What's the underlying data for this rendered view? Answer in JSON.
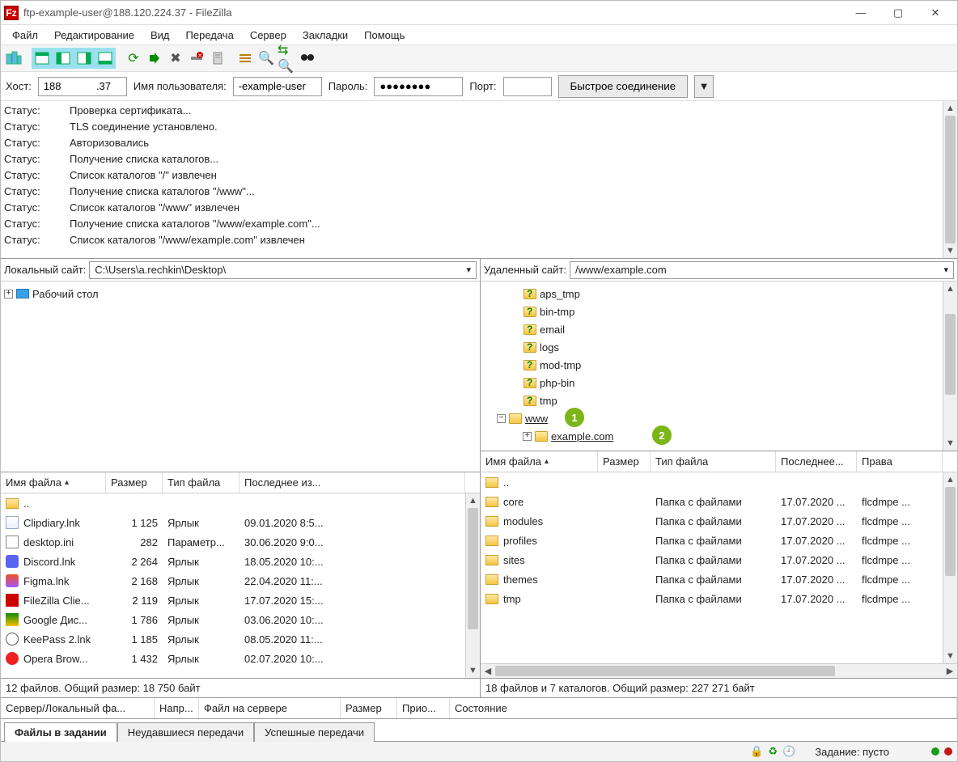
{
  "window": {
    "title": "ftp-example-user@188.120.224.37 - FileZilla",
    "controls": {
      "min": "—",
      "max": "▢",
      "close": "✕"
    }
  },
  "menu": [
    "Файл",
    "Редактирование",
    "Вид",
    "Передача",
    "Сервер",
    "Закладки",
    "Помощь"
  ],
  "quickconnect": {
    "host_label": "Хост:",
    "host_value": "188            .37",
    "user_label": "Имя пользователя:",
    "user_value": "-example-user",
    "pass_label": "Пароль:",
    "pass_value": "●●●●●●●●",
    "port_label": "Порт:",
    "port_value": "",
    "button": "Быстрое соединение",
    "drop": "▼"
  },
  "log": [
    {
      "k": "Статус:",
      "v": "Проверка сертификата..."
    },
    {
      "k": "Статус:",
      "v": "TLS соединение установлено."
    },
    {
      "k": "Статус:",
      "v": "Авторизовались"
    },
    {
      "k": "Статус:",
      "v": "Получение списка каталогов..."
    },
    {
      "k": "Статус:",
      "v": "Список каталогов \"/\" извлечен"
    },
    {
      "k": "Статус:",
      "v": "Получение списка каталогов \"/www\"..."
    },
    {
      "k": "Статус:",
      "v": "Список каталогов \"/www\" извлечен"
    },
    {
      "k": "Статус:",
      "v": "Получение списка каталогов \"/www/example.com\"..."
    },
    {
      "k": "Статус:",
      "v": "Список каталогов \"/www/example.com\" извлечен"
    }
  ],
  "local": {
    "site_label": "Локальный сайт:",
    "path": "C:\\Users\\a.rechkin\\Desktop\\",
    "tree_root": "Рабочий стол",
    "headers": {
      "name": "Имя файла",
      "size": "Размер",
      "type": "Тип файла",
      "date": "Последнее из..."
    },
    "up": "..",
    "files": [
      {
        "name": "Clipdiary.lnk",
        "size": "1 125",
        "type": "Ярлык",
        "date": "09.01.2020 8:5...",
        "ico": "file"
      },
      {
        "name": "desktop.ini",
        "size": "282",
        "type": "Параметр...",
        "date": "30.06.2020 9:0...",
        "ico": "file-gear"
      },
      {
        "name": "Discord.lnk",
        "size": "2 264",
        "type": "Ярлык",
        "date": "18.05.2020 10:...",
        "ico": "discord"
      },
      {
        "name": "Figma.lnk",
        "size": "2 168",
        "type": "Ярлык",
        "date": "22.04.2020 11:...",
        "ico": "figma"
      },
      {
        "name": "FileZilla Clie...",
        "size": "2 119",
        "type": "Ярлык",
        "date": "17.07.2020 15:...",
        "ico": "filezilla"
      },
      {
        "name": "Google Дис...",
        "size": "1 786",
        "type": "Ярлык",
        "date": "03.06.2020 10:...",
        "ico": "drive"
      },
      {
        "name": "KeePass 2.lnk",
        "size": "1 185",
        "type": "Ярлык",
        "date": "08.05.2020 11:...",
        "ico": "keepass"
      },
      {
        "name": "Opera Brow...",
        "size": "1 432",
        "type": "Ярлык",
        "date": "02.07.2020 10:...",
        "ico": "opera"
      }
    ],
    "summary": "12 файлов. Общий размер: 18 750 байт"
  },
  "remote": {
    "site_label": "Удаленный сайт:",
    "path": "/www/example.com",
    "tree": [
      "aps_tmp",
      "bin-tmp",
      "email",
      "logs",
      "mod-tmp",
      "php-bin",
      "tmp"
    ],
    "www_label": "www",
    "example_label": "example.com",
    "badge1": "1",
    "badge2": "2",
    "headers": {
      "name": "Имя файла",
      "size": "Размер",
      "type": "Тип файла",
      "date": "Последнее...",
      "perm": "Права"
    },
    "up": "..",
    "files": [
      {
        "name": "core",
        "type": "Папка с файлами",
        "date": "17.07.2020 ...",
        "perm": "flcdmpe ..."
      },
      {
        "name": "modules",
        "type": "Папка с файлами",
        "date": "17.07.2020 ...",
        "perm": "flcdmpe ..."
      },
      {
        "name": "profiles",
        "type": "Папка с файлами",
        "date": "17.07.2020 ...",
        "perm": "flcdmpe ..."
      },
      {
        "name": "sites",
        "type": "Папка с файлами",
        "date": "17.07.2020 ...",
        "perm": "flcdmpe ..."
      },
      {
        "name": "themes",
        "type": "Папка с файлами",
        "date": "17.07.2020 ...",
        "perm": "flcdmpe ..."
      },
      {
        "name": "tmp",
        "type": "Папка с файлами",
        "date": "17.07.2020 ...",
        "perm": "flcdmpe ..."
      }
    ],
    "summary": "18 файлов и 7 каталогов. Общий размер: 227 271 байт"
  },
  "queue_headers": [
    "Сервер/Локальный фа...",
    "Напр...",
    "Файл на сервере",
    "Размер",
    "Прио...",
    "Состояние"
  ],
  "tabs": {
    "a": "Файлы в задании",
    "b": "Неудавшиеся передачи",
    "c": "Успешные передачи"
  },
  "status": {
    "queue_label": "Задание: пусто"
  }
}
